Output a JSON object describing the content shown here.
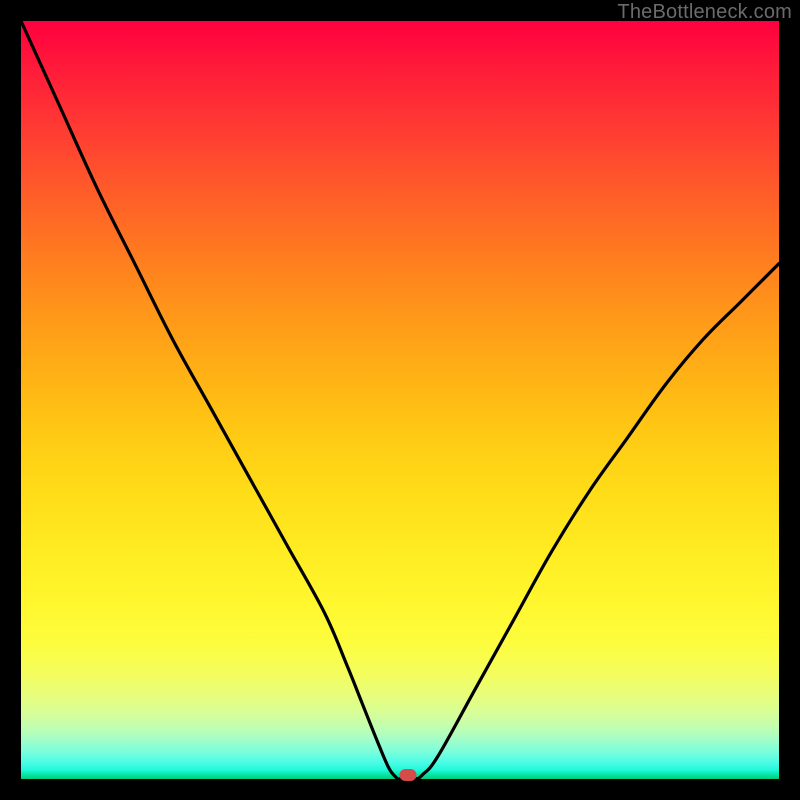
{
  "watermark": {
    "text": "TheBottleneck.com"
  },
  "colors": {
    "frame": "#000000",
    "curve_stroke": "#000000",
    "marker_fill": "#d74a4a",
    "gradient_top": "#ff0040",
    "gradient_bottom": "#02cc7a"
  },
  "chart_data": {
    "type": "line",
    "title": "",
    "xlabel": "",
    "ylabel": "",
    "xlim": [
      0,
      100
    ],
    "ylim": [
      0,
      100
    ],
    "grid": false,
    "series": [
      {
        "name": "bottleneck-curve",
        "x": [
          0,
          5,
          10,
          15,
          20,
          25,
          30,
          35,
          40,
          43,
          45,
          47,
          48.5,
          49.5,
          50,
          52,
          53,
          55,
          60,
          65,
          70,
          75,
          80,
          85,
          90,
          95,
          100
        ],
        "values": [
          100,
          89,
          78,
          68,
          58,
          49,
          40,
          31,
          22,
          15,
          10,
          5,
          1.5,
          0.2,
          0,
          0,
          0.6,
          3,
          12,
          21,
          30,
          38,
          45,
          52,
          58,
          63,
          68
        ]
      }
    ],
    "marker": {
      "x": 51,
      "y": 0
    }
  }
}
